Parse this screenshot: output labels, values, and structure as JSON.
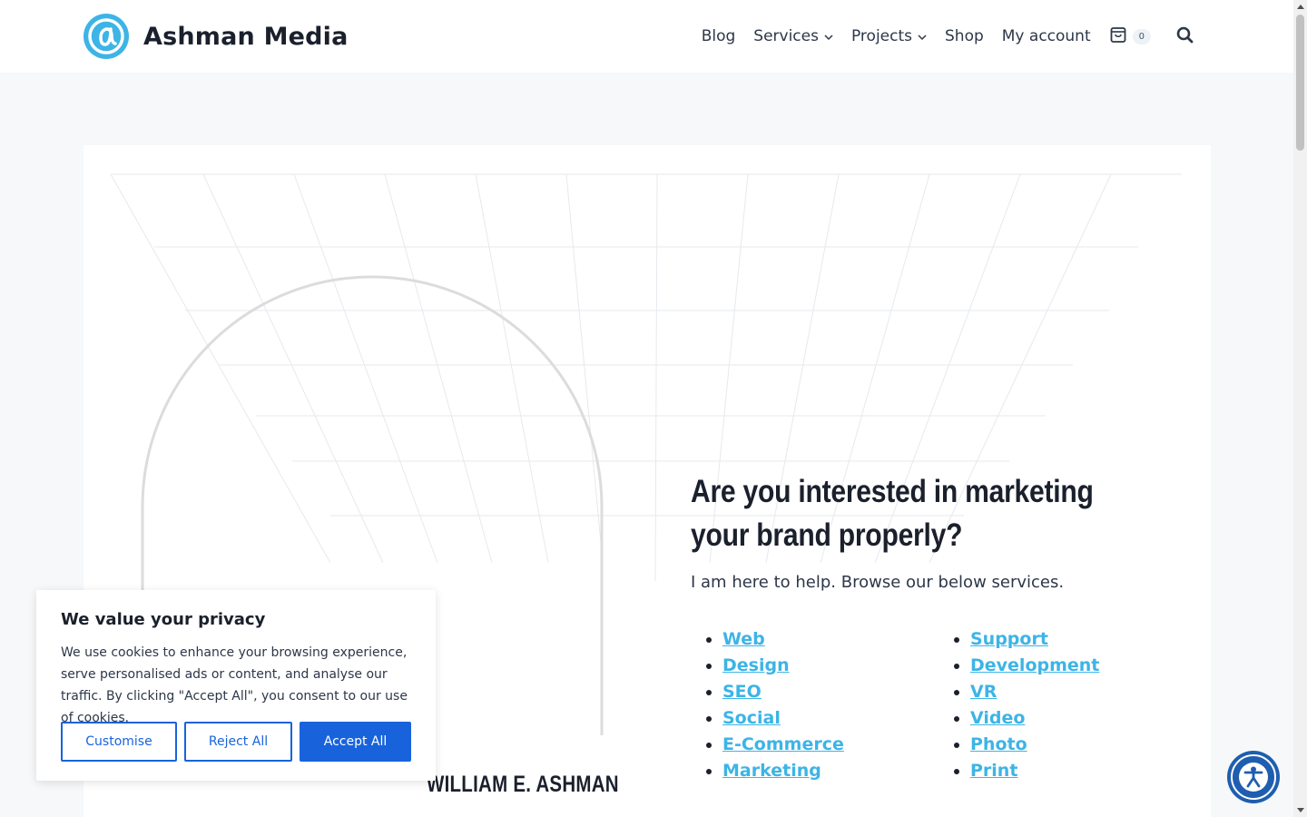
{
  "header": {
    "site_name": "Ashman Media",
    "nav": {
      "blog": "Blog",
      "services": "Services",
      "projects": "Projects",
      "shop": "Shop",
      "account": "My account"
    },
    "cart_count": "0"
  },
  "hero": {
    "headline": "Are you interested in marketing your brand properly?",
    "subhead": "I am here to help. Browse our below services.",
    "services_left": [
      "Web",
      "Design",
      "SEO",
      "Social",
      "E-Commerce",
      "Marketing"
    ],
    "services_right": [
      "Support",
      "Development",
      "VR",
      "Video",
      "Photo",
      "Print"
    ],
    "person_name": "WILLIAM E. ASHMAN"
  },
  "cookie_banner": {
    "title": "We value your privacy",
    "text": "We use cookies to enhance your browsing experience, serve personalised ads or content, and analyse our traffic. By clicking \"Accept All\", you consent to our use of cookies.",
    "customise": "Customise",
    "reject": "Reject All",
    "accept": "Accept All"
  },
  "colors": {
    "accent": "#3db4e6",
    "button_blue": "#1863dc",
    "a11y_blue": "#1f5eaf",
    "page_bg": "#f6f8fa"
  },
  "icons": {
    "logo": "at-sign-logo-icon",
    "cart": "shopping-bag-icon",
    "search": "search-icon",
    "chevron": "chevron-down-icon",
    "accessibility": "accessibility-icon"
  }
}
